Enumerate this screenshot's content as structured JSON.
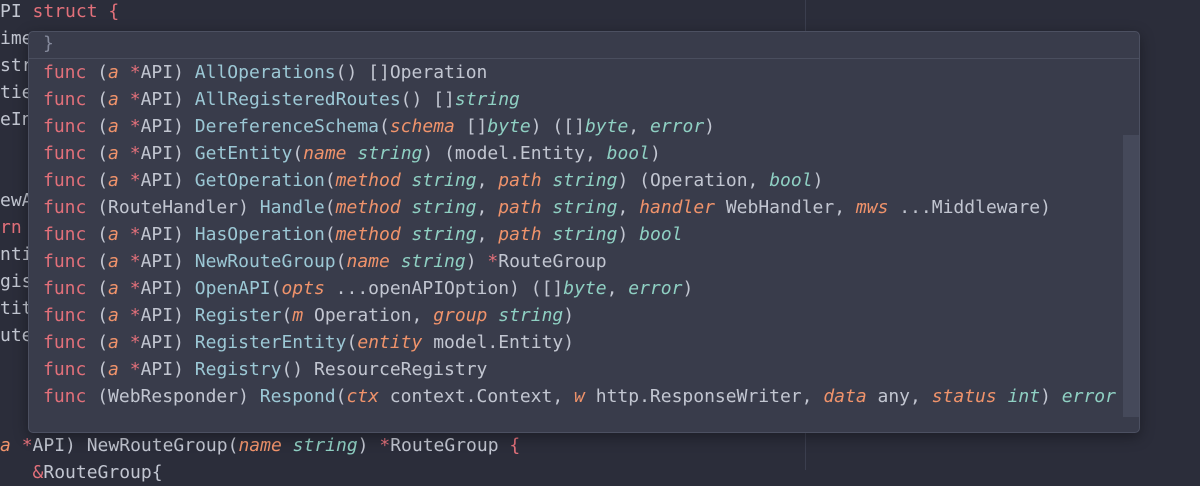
{
  "background_code": [
    {
      "y": "bg0",
      "parts": [
        [
          "dim",
          "PI "
        ],
        [
          "kw",
          "struct"
        ],
        [
          "dim",
          " "
        ],
        [
          "op",
          "{"
        ]
      ]
    },
    {
      "y": "bg1",
      "parts": [
        [
          "dim",
          "ime"
        ]
      ]
    },
    {
      "y": "bg2",
      "parts": [
        [
          "dim",
          "str"
        ]
      ]
    },
    {
      "y": "bg3",
      "parts": [
        [
          "dim",
          "tie"
        ]
      ]
    },
    {
      "y": "bg4",
      "parts": [
        [
          "dim",
          "eIn"
        ]
      ]
    },
    {
      "y": "bg7",
      "parts": [
        [
          "dim",
          "ewA"
        ]
      ]
    },
    {
      "y": "bg8",
      "parts": [
        [
          "kw",
          "rn"
        ]
      ]
    },
    {
      "y": "bg9",
      "parts": [
        [
          "dim",
          "nti"
        ]
      ]
    },
    {
      "y": "bg10",
      "parts": [
        [
          "dim",
          "gis"
        ]
      ]
    },
    {
      "y": "bg11",
      "parts": [
        [
          "dim",
          "tit"
        ]
      ]
    },
    {
      "y": "bg12",
      "parts": [
        [
          "dim",
          "ute"
        ]
      ]
    },
    {
      "y": "bg16",
      "parts": [
        [
          "pm",
          "a"
        ],
        [
          "dim",
          " "
        ],
        [
          "op",
          "*"
        ],
        [
          "dim",
          "API) NewRouteGroup("
        ],
        [
          "pm",
          "name"
        ],
        [
          "dim",
          " "
        ],
        [
          "ty",
          "string"
        ],
        [
          "dim",
          ") "
        ],
        [
          "op",
          "*"
        ],
        [
          "dim",
          "RouteGroup "
        ],
        [
          "op",
          "{"
        ]
      ]
    },
    {
      "y": "bg17",
      "parts": [
        [
          "dim",
          "   "
        ],
        [
          "op",
          "&"
        ],
        [
          "dim",
          "RouteGroup{"
        ]
      ]
    }
  ],
  "popup": {
    "header": "}",
    "items": [
      [
        [
          "kw",
          "func"
        ],
        [
          "dim",
          " ("
        ],
        [
          "pm",
          "a"
        ],
        [
          "dim",
          " "
        ],
        [
          "op",
          "*"
        ],
        [
          "dim",
          "API) "
        ],
        [
          "fn",
          "AllOperations"
        ],
        [
          "dim",
          "() []Operation"
        ]
      ],
      [
        [
          "kw",
          "func"
        ],
        [
          "dim",
          " ("
        ],
        [
          "pm",
          "a"
        ],
        [
          "dim",
          " "
        ],
        [
          "op",
          "*"
        ],
        [
          "dim",
          "API) "
        ],
        [
          "fn",
          "AllRegisteredRoutes"
        ],
        [
          "dim",
          "() []"
        ],
        [
          "ty",
          "string"
        ]
      ],
      [
        [
          "kw",
          "func"
        ],
        [
          "dim",
          " ("
        ],
        [
          "pm",
          "a"
        ],
        [
          "dim",
          " "
        ],
        [
          "op",
          "*"
        ],
        [
          "dim",
          "API) "
        ],
        [
          "fn",
          "DereferenceSchema"
        ],
        [
          "dim",
          "("
        ],
        [
          "pm",
          "schema"
        ],
        [
          "dim",
          " []"
        ],
        [
          "ty",
          "byte"
        ],
        [
          "dim",
          ") ([]"
        ],
        [
          "ty",
          "byte"
        ],
        [
          "dim",
          ", "
        ],
        [
          "ty",
          "error"
        ],
        [
          "dim",
          ")"
        ]
      ],
      [
        [
          "kw",
          "func"
        ],
        [
          "dim",
          " ("
        ],
        [
          "pm",
          "a"
        ],
        [
          "dim",
          " "
        ],
        [
          "op",
          "*"
        ],
        [
          "dim",
          "API) "
        ],
        [
          "fn",
          "GetEntity"
        ],
        [
          "dim",
          "("
        ],
        [
          "pm",
          "name"
        ],
        [
          "dim",
          " "
        ],
        [
          "ty",
          "string"
        ],
        [
          "dim",
          ") (model.Entity, "
        ],
        [
          "ty",
          "bool"
        ],
        [
          "dim",
          ")"
        ]
      ],
      [
        [
          "kw",
          "func"
        ],
        [
          "dim",
          " ("
        ],
        [
          "pm",
          "a"
        ],
        [
          "dim",
          " "
        ],
        [
          "op",
          "*"
        ],
        [
          "dim",
          "API) "
        ],
        [
          "fn",
          "GetOperation"
        ],
        [
          "dim",
          "("
        ],
        [
          "pm",
          "method"
        ],
        [
          "dim",
          " "
        ],
        [
          "ty",
          "string"
        ],
        [
          "dim",
          ", "
        ],
        [
          "pm",
          "path"
        ],
        [
          "dim",
          " "
        ],
        [
          "ty",
          "string"
        ],
        [
          "dim",
          ") (Operation, "
        ],
        [
          "ty",
          "bool"
        ],
        [
          "dim",
          ")"
        ]
      ],
      [
        [
          "kw",
          "func"
        ],
        [
          "dim",
          " (RouteHandler) "
        ],
        [
          "fn",
          "Handle"
        ],
        [
          "dim",
          "("
        ],
        [
          "pm",
          "method"
        ],
        [
          "dim",
          " "
        ],
        [
          "ty",
          "string"
        ],
        [
          "dim",
          ", "
        ],
        [
          "pm",
          "path"
        ],
        [
          "dim",
          " "
        ],
        [
          "ty",
          "string"
        ],
        [
          "dim",
          ", "
        ],
        [
          "pm",
          "handler"
        ],
        [
          "dim",
          " WebHandler, "
        ],
        [
          "pm",
          "mws"
        ],
        [
          "dim",
          " ...Middleware)"
        ]
      ],
      [
        [
          "kw",
          "func"
        ],
        [
          "dim",
          " ("
        ],
        [
          "pm",
          "a"
        ],
        [
          "dim",
          " "
        ],
        [
          "op",
          "*"
        ],
        [
          "dim",
          "API) "
        ],
        [
          "fn",
          "HasOperation"
        ],
        [
          "dim",
          "("
        ],
        [
          "pm",
          "method"
        ],
        [
          "dim",
          " "
        ],
        [
          "ty",
          "string"
        ],
        [
          "dim",
          ", "
        ],
        [
          "pm",
          "path"
        ],
        [
          "dim",
          " "
        ],
        [
          "ty",
          "string"
        ],
        [
          "dim",
          ") "
        ],
        [
          "ty",
          "bool"
        ]
      ],
      [
        [
          "kw",
          "func"
        ],
        [
          "dim",
          " ("
        ],
        [
          "pm",
          "a"
        ],
        [
          "dim",
          " "
        ],
        [
          "op",
          "*"
        ],
        [
          "dim",
          "API) "
        ],
        [
          "fn",
          "NewRouteGroup"
        ],
        [
          "dim",
          "("
        ],
        [
          "pm",
          "name"
        ],
        [
          "dim",
          " "
        ],
        [
          "ty",
          "string"
        ],
        [
          "dim",
          ") "
        ],
        [
          "op",
          "*"
        ],
        [
          "dim",
          "RouteGroup"
        ]
      ],
      [
        [
          "kw",
          "func"
        ],
        [
          "dim",
          " ("
        ],
        [
          "pm",
          "a"
        ],
        [
          "dim",
          " "
        ],
        [
          "op",
          "*"
        ],
        [
          "dim",
          "API) "
        ],
        [
          "fn",
          "OpenAPI"
        ],
        [
          "dim",
          "("
        ],
        [
          "pm",
          "opts"
        ],
        [
          "dim",
          " ...openAPIOption) ([]"
        ],
        [
          "ty",
          "byte"
        ],
        [
          "dim",
          ", "
        ],
        [
          "ty",
          "error"
        ],
        [
          "dim",
          ")"
        ]
      ],
      [
        [
          "kw",
          "func"
        ],
        [
          "dim",
          " ("
        ],
        [
          "pm",
          "a"
        ],
        [
          "dim",
          " "
        ],
        [
          "op",
          "*"
        ],
        [
          "dim",
          "API) "
        ],
        [
          "fn",
          "Register"
        ],
        [
          "dim",
          "("
        ],
        [
          "pm",
          "m"
        ],
        [
          "dim",
          " Operation, "
        ],
        [
          "pm",
          "group"
        ],
        [
          "dim",
          " "
        ],
        [
          "ty",
          "string"
        ],
        [
          "dim",
          ")"
        ]
      ],
      [
        [
          "kw",
          "func"
        ],
        [
          "dim",
          " ("
        ],
        [
          "pm",
          "a"
        ],
        [
          "dim",
          " "
        ],
        [
          "op",
          "*"
        ],
        [
          "dim",
          "API) "
        ],
        [
          "fn",
          "RegisterEntity"
        ],
        [
          "dim",
          "("
        ],
        [
          "pm",
          "entity"
        ],
        [
          "dim",
          " model.Entity)"
        ]
      ],
      [
        [
          "kw",
          "func"
        ],
        [
          "dim",
          " ("
        ],
        [
          "pm",
          "a"
        ],
        [
          "dim",
          " "
        ],
        [
          "op",
          "*"
        ],
        [
          "dim",
          "API) "
        ],
        [
          "fn",
          "Registry"
        ],
        [
          "dim",
          "() ResourceRegistry"
        ]
      ],
      [
        [
          "kw",
          "func"
        ],
        [
          "dim",
          " (WebResponder) "
        ],
        [
          "fn",
          "Respond"
        ],
        [
          "dim",
          "("
        ],
        [
          "pm",
          "ctx"
        ],
        [
          "dim",
          " context.Context, "
        ],
        [
          "pm",
          "w"
        ],
        [
          "dim",
          " http.ResponseWriter, "
        ],
        [
          "pm",
          "data"
        ],
        [
          "dim",
          " any, "
        ],
        [
          "pm",
          "status"
        ],
        [
          "dim",
          " "
        ],
        [
          "ty",
          "int"
        ],
        [
          "dim",
          ") "
        ],
        [
          "ty",
          "error"
        ]
      ]
    ]
  },
  "colors": {
    "editor_bg": "#2b2d3a",
    "popup_bg": "#393c4b",
    "keyword": "#e2707a",
    "type": "#8fd0c3",
    "param": "#f0936b"
  }
}
